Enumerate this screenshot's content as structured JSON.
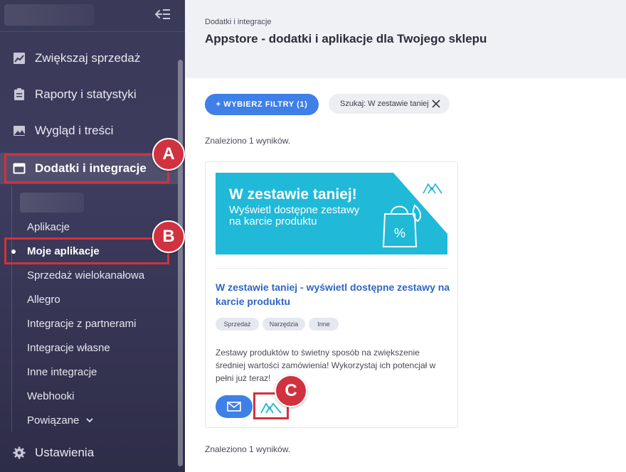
{
  "sidebar": {
    "collapse_icon": "collapse-menu-icon",
    "items": [
      {
        "label": "Zwiększaj sprzedaż",
        "icon": "chart-icon"
      },
      {
        "label": "Raporty i statystyki",
        "icon": "clipboard-icon"
      },
      {
        "label": "Wygląd i treści",
        "icon": "image-icon"
      },
      {
        "label": "Dodatki i integracje",
        "icon": "window-icon"
      }
    ],
    "sub_items": [
      "Aplikacje",
      "Moje aplikacje",
      "Sprzedaż wielokanałowa",
      "Allegro",
      "Integracje z partnerami",
      "Integracje własne",
      "Inne integracje",
      "Webhooki",
      "Powiązane"
    ],
    "settings_label": "Ustawienia",
    "settings_icon": "gear-icon"
  },
  "header": {
    "breadcrumb": "Dodatki i integracje",
    "title": "Appstore - dodatki i aplikacje dla Twojego sklepu"
  },
  "filters": {
    "button_label": "+ WYBIERZ FILTRY (1)",
    "search_chip": "Szukaj: W zestawie taniej"
  },
  "results_text": "Znaleziono 1 wyników.",
  "card": {
    "banner_line1": "W zestawie taniej!",
    "banner_line2": "Wyświetl dostępne zestawy na karcie produktu",
    "title": "W zestawie taniej - wyświetl dostępne zestawy na karcie produktu",
    "tags": [
      "Sprzedaż",
      "Narzędzia",
      "Inne"
    ],
    "description": "Zestawy produktów to świetny sposób na zwiększenie średniej wartości zamówienia! Wykorzystaj ich potencjał w pełni już teraz!"
  },
  "callouts": {
    "a": "A",
    "b": "B",
    "c": "C"
  },
  "colors": {
    "sidebar_bg": "#3a3958",
    "accent_blue": "#3f7fe8",
    "callout_red": "#d1323f",
    "banner_cyan": "#20b9d8"
  }
}
